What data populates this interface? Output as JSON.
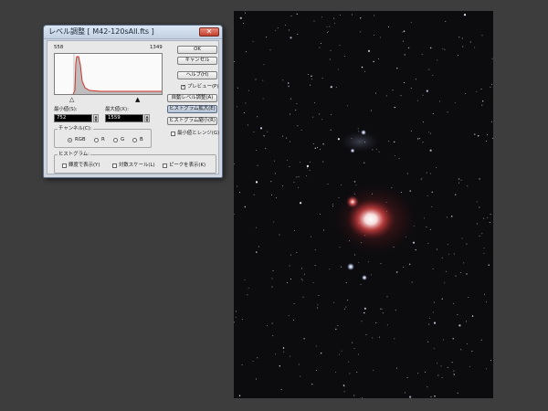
{
  "dialog": {
    "title": "レベル調整 [ M42-120sAll.fts ]",
    "close_label": "✕",
    "histogram": {
      "min_label": "558",
      "max_label": "1349",
      "low_marker": "△",
      "high_marker": "▲"
    },
    "min_value_label": "最小値(S):",
    "min_value": "752",
    "max_value_label": "最大値(X):",
    "max_value": "1559",
    "buttons": {
      "ok": "OK",
      "cancel": "キャンセル",
      "help": "ヘルプ(H)",
      "auto_level": "自動レベル調整(A)",
      "expand_histogram": "ヒストグラム拡大(E)",
      "shrink_histogram": "ヒストグラム縮小(R)",
      "min_max_range": "最小値とレンジ(G)"
    },
    "preview_label": "プレビュー(P)",
    "channel": {
      "group_label": "チャンネル(C):",
      "options": [
        "RGB",
        "R",
        "G",
        "B"
      ],
      "selected": "RGB"
    },
    "histogram_group": {
      "group_label": "ヒストグラム:",
      "options": [
        "輝度で表示(Y)",
        "対数スケール(L)",
        "ピークを表示(K)"
      ]
    }
  },
  "colors": {
    "dialog_bg": "#e8e8e8",
    "histogram_fill": "#bdbdbd",
    "histogram_red": "#d0322a",
    "image_bg": "#0c0c0f",
    "nebula": "#e04848"
  }
}
